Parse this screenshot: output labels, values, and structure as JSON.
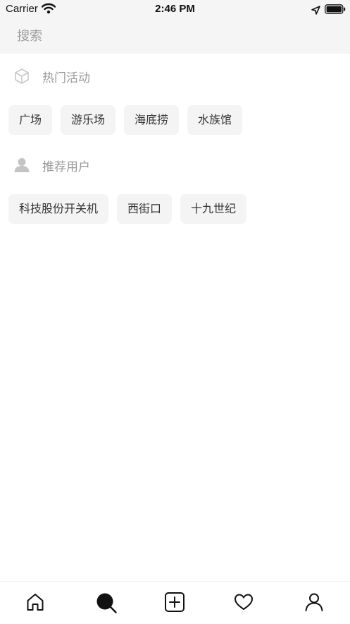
{
  "status_bar": {
    "carrier": "Carrier",
    "time": "2:46 PM"
  },
  "search": {
    "placeholder": "搜索"
  },
  "hot_events": {
    "title": "热门活动",
    "icon": "cube-icon",
    "tags": [
      "广场",
      "游乐场",
      "海底捞",
      "水族馆"
    ]
  },
  "recommended_users": {
    "title": "推荐用户",
    "icon": "user-icon",
    "tags": [
      "科技股份开关机",
      "西街口",
      "十九世纪"
    ]
  },
  "tab_bar": {
    "items": [
      {
        "name": "home",
        "icon": "home-icon"
      },
      {
        "name": "search",
        "icon": "search-icon",
        "active": true
      },
      {
        "name": "add",
        "icon": "add-icon"
      },
      {
        "name": "likes",
        "icon": "heart-icon"
      },
      {
        "name": "profile",
        "icon": "profile-icon"
      }
    ]
  },
  "colors": {
    "background": "#ffffff",
    "search_bar": "#f5f5f5",
    "chip": "#f4f4f4",
    "muted_text": "#9a9a9a",
    "text": "#333333"
  }
}
